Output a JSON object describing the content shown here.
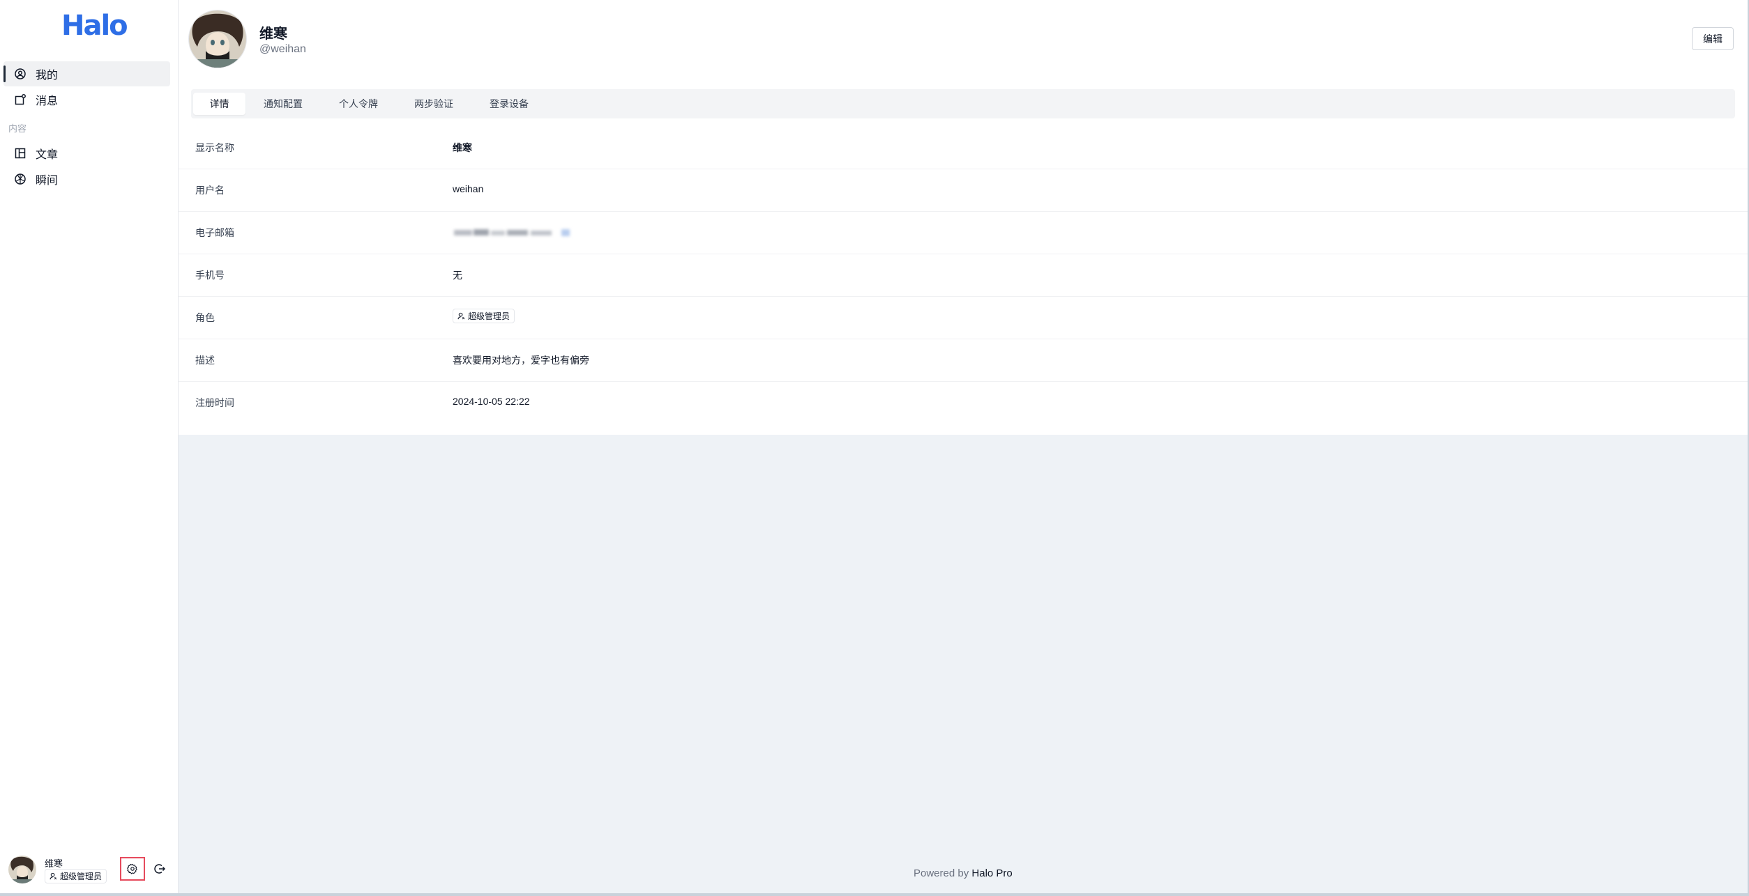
{
  "app": {
    "logo": "Halo"
  },
  "sidebar": {
    "items": [
      {
        "label": "我的",
        "icon": "user-circle-icon",
        "active": true
      },
      {
        "label": "消息",
        "icon": "notification-icon",
        "active": false
      }
    ],
    "group_label": "内容",
    "content_items": [
      {
        "label": "文章",
        "icon": "article-layout-icon"
      },
      {
        "label": "瞬间",
        "icon": "moments-icon"
      }
    ],
    "user": {
      "name": "维寒",
      "role": "超级管理员"
    }
  },
  "profile": {
    "display_name": "维寒",
    "handle": "@weihan",
    "edit_label": "编辑"
  },
  "tabs": [
    {
      "label": "详情",
      "active": true
    },
    {
      "label": "通知配置"
    },
    {
      "label": "个人令牌"
    },
    {
      "label": "两步验证"
    },
    {
      "label": "登录设备"
    }
  ],
  "details": [
    {
      "key": "显示名称",
      "value": "维寒"
    },
    {
      "key": "用户名",
      "value": "weihan"
    },
    {
      "key": "电子邮箱",
      "value": ""
    },
    {
      "key": "手机号",
      "value": "无"
    },
    {
      "key": "角色",
      "value": "超级管理员"
    },
    {
      "key": "描述",
      "value": "喜欢要用对地方，爱字也有偏旁"
    },
    {
      "key": "注册时间",
      "value": "2024-10-05 22:22"
    }
  ],
  "footer": {
    "prefix": "Powered by ",
    "brand": "Halo Pro"
  },
  "colors": {
    "accent": "#2e6ee6",
    "highlight_border": "#e64b5d",
    "background": "#eef2f6"
  }
}
